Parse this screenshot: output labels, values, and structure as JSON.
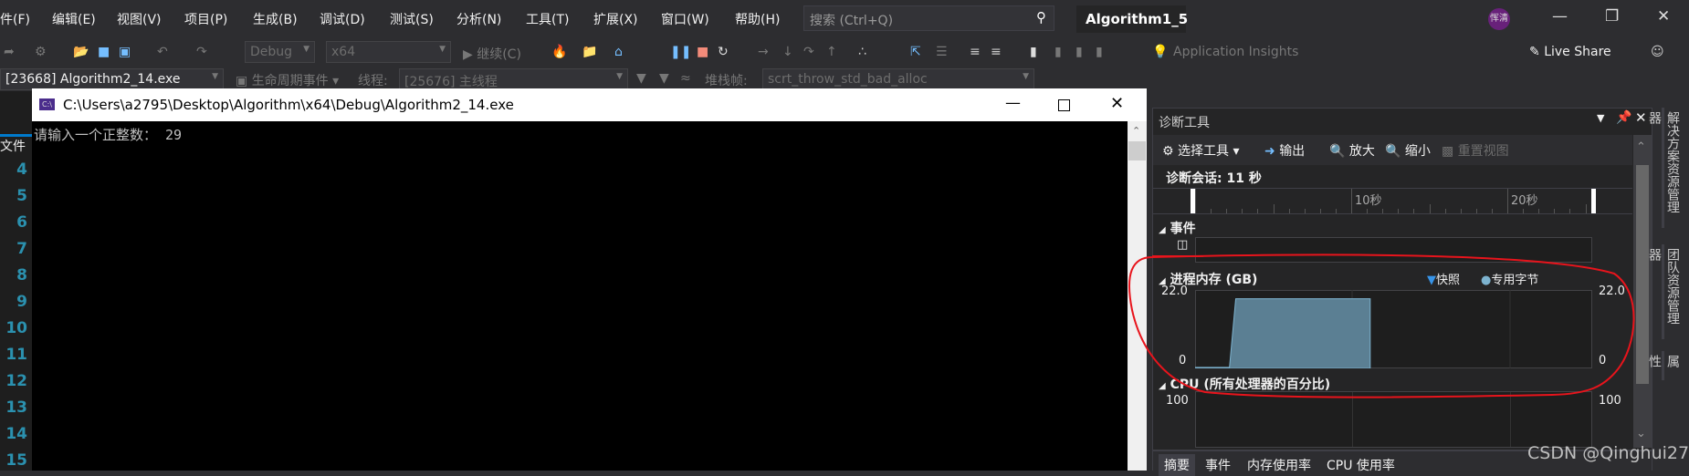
{
  "menubar": {
    "items": [
      "件(F)",
      "编辑(E)",
      "视图(V)",
      "项目(P)",
      "生成(B)",
      "调试(D)",
      "测试(S)",
      "分析(N)",
      "工具(T)",
      "扩展(X)",
      "窗口(W)",
      "帮助(H)"
    ],
    "search_placeholder": "搜索 (Ctrl+Q)",
    "solution_title": "Algorithm1_5",
    "avatar": "恽清"
  },
  "toolbar": {
    "config": "Debug",
    "platform": "x64",
    "continue": "继续(C)",
    "app_insights": "Application Insights",
    "live_share": "Live Share"
  },
  "debug_location": {
    "process": "[23668] Algorithm2_14.exe",
    "lifecycle": "生命周期事件",
    "thread_label": "线程:",
    "thread": "[25676] 主线程",
    "stack_label": "堆栈帧:",
    "stack": "scrt_throw_std_bad_alloc"
  },
  "editor": {
    "tab": "文件",
    "line_numbers": [
      "4",
      "5",
      "6",
      "7",
      "8",
      "9",
      "10",
      "11",
      "12",
      "13",
      "14",
      "15"
    ]
  },
  "console": {
    "title": "C:\\Users\\a2795\\Desktop\\Algorithm\\x64\\Debug\\Algorithm2_14.exe",
    "icon": "C:\\",
    "output": "请输入一个正整数： 29"
  },
  "diagnostics": {
    "title": "诊断工具",
    "select_tools": "选择工具",
    "output": "输出",
    "zoom_in": "放大",
    "zoom_out": "缩小",
    "reset_view": "重置视图",
    "session": "诊断会话: 11 秒",
    "ruler_labels": [
      "10秒",
      "20秒"
    ],
    "events_header": "事件",
    "memory_header": "进程内存 (GB)",
    "legend_snapshot": "快照",
    "legend_private": "专用字节",
    "mem_max": "22.0",
    "mem_min": "0",
    "cpu_header": "CPU (所有处理器的百分比)",
    "cpu_max": "100",
    "tabs": [
      "摘要",
      "事件",
      "内存使用率",
      "CPU 使用率"
    ]
  },
  "side_tabs": [
    "解决方案资源管理器",
    "团队资源管理器",
    "属性"
  ],
  "watermark": "CSDN @Qinghui27",
  "colors": {
    "memory_fill": "#5b7f93",
    "snapshot": "#3794e8",
    "private_bytes": "#7db3cf",
    "annotation": "#e8141c"
  },
  "chart_data": {
    "type": "area",
    "title": "进程内存 (GB)",
    "xlabel": "",
    "ylabel": "",
    "x_unit": "秒",
    "xlim": [
      0,
      25.4
    ],
    "ylim": [
      0,
      22.0
    ],
    "series": [
      {
        "name": "专用字节",
        "x": [
          0,
          2.2,
          2.6,
          11.2
        ],
        "y": [
          0.3,
          0.3,
          20,
          20
        ]
      }
    ]
  }
}
